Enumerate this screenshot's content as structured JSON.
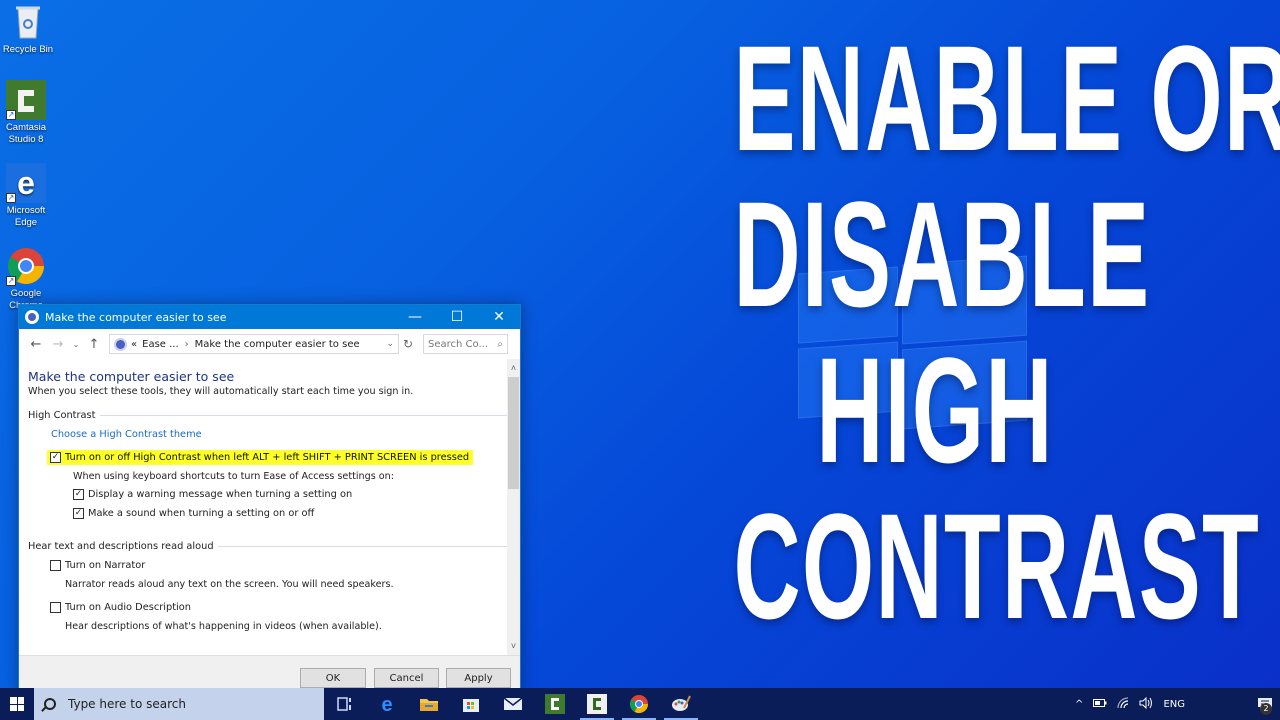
{
  "desktop": {
    "icons": [
      {
        "name": "recycle-bin",
        "label": "Recycle Bin"
      },
      {
        "name": "camtasia",
        "label": "Camtasia Studio 8"
      },
      {
        "name": "microsoft-edge",
        "label": "Microsoft Edge"
      },
      {
        "name": "google-chrome",
        "label": "Google Chrome"
      }
    ]
  },
  "headline": {
    "lines": [
      "ENABLE OR",
      "DISABLE",
      "HIGH",
      "CONTRAST"
    ],
    "color": "#ffffff"
  },
  "window": {
    "title": "Make the computer easier to see",
    "controls": {
      "minimize": "—",
      "maximize": "☐",
      "close": "✕"
    },
    "address": {
      "overflow": "«",
      "crumbs": [
        "Ease ...",
        "Make the computer easier to see"
      ],
      "separator": "›"
    },
    "search_placeholder": "Search Co...",
    "heading": "Make the computer easier to see",
    "subheading": "When you select these tools, they will automatically start each time you sign in.",
    "sections": [
      {
        "title": "High Contrast",
        "link": "Choose a High Contrast theme",
        "highlighted_option": {
          "label": "Turn on or off High Contrast when left ALT + left SHIFT + PRINT SCREEN is pressed",
          "checked": true
        },
        "note": "When using keyboard shortcuts to turn Ease of Access settings on:",
        "options": [
          {
            "label": "Display a warning message when turning a setting on",
            "checked": true
          },
          {
            "label": "Make a sound when turning a setting on or off",
            "checked": true
          }
        ]
      },
      {
        "title": "Hear text and descriptions read aloud",
        "options": [
          {
            "label": "Turn on Narrator",
            "checked": false,
            "description": "Narrator reads aloud any text on the screen. You will need speakers."
          },
          {
            "label": "Turn on Audio Description",
            "checked": false,
            "description": "Hear descriptions of what's happening in videos (when available)."
          }
        ]
      }
    ],
    "buttons": {
      "ok": "OK",
      "cancel": "Cancel",
      "apply": "Apply"
    },
    "highlight_color": "#ffff2a",
    "accent": "#0078d7"
  },
  "taskbar": {
    "search_placeholder": "Type here to search",
    "apps": [
      "task-view",
      "edge",
      "file-explorer",
      "store",
      "mail",
      "camtasia",
      "camtasia-recorder",
      "chrome",
      "paint"
    ],
    "tray": {
      "language": "ENG",
      "notifications": "2"
    }
  },
  "glyphs": {
    "check": "✓",
    "back": "←",
    "forward": "→",
    "recent": "⌄",
    "up": "↑",
    "refresh": "↻",
    "search": "⌕",
    "dropdown": "⌄",
    "scroll_up": "˄",
    "scroll_down": "˅",
    "tray_up": "^"
  }
}
